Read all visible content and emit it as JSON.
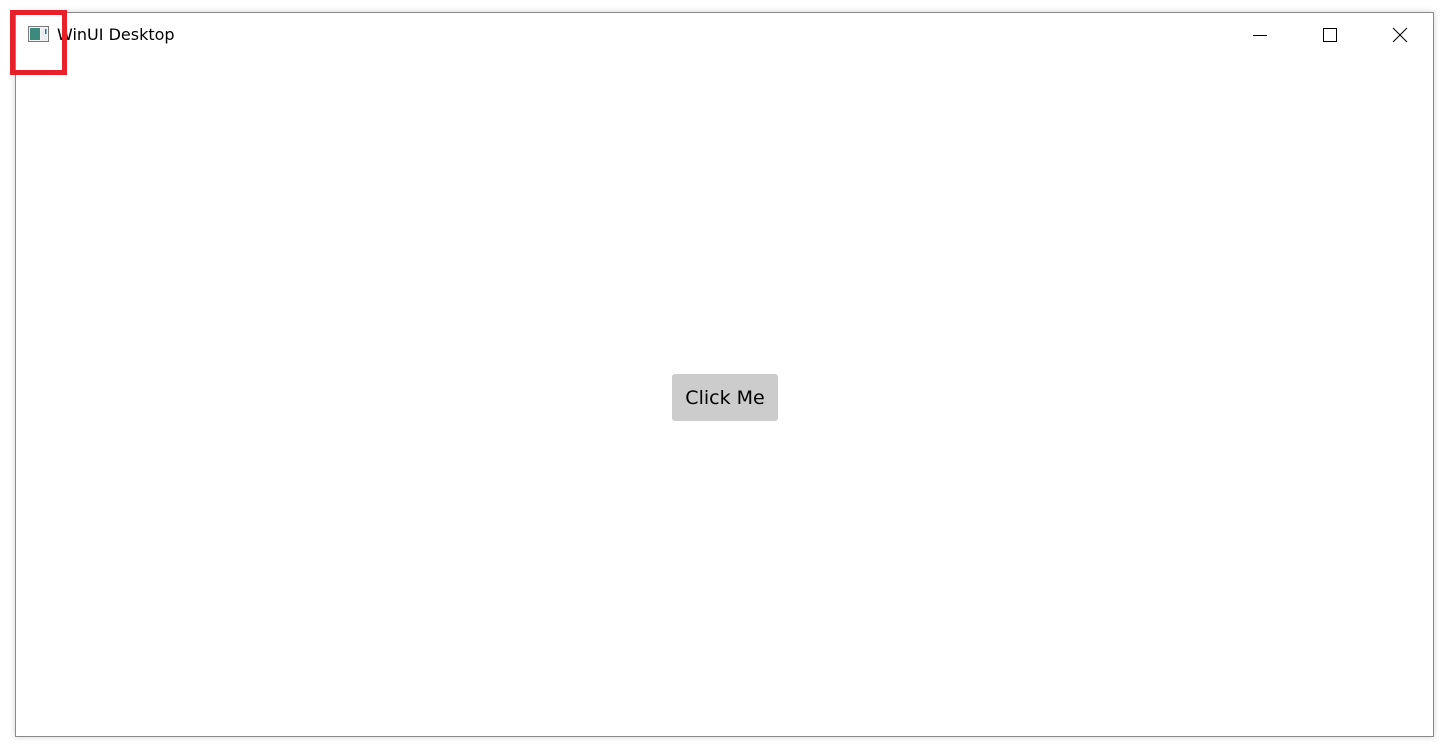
{
  "window": {
    "title": "WinUI Desktop",
    "icon": "app-window-icon",
    "controls": {
      "minimize_icon": "minimize-icon",
      "maximize_icon": "maximize-icon",
      "close_icon": "close-icon"
    }
  },
  "content": {
    "button_label": "Click Me"
  },
  "colors": {
    "button_bg": "#cccccc",
    "highlight": "#e8202a",
    "window_border": "#8a8a8a"
  }
}
